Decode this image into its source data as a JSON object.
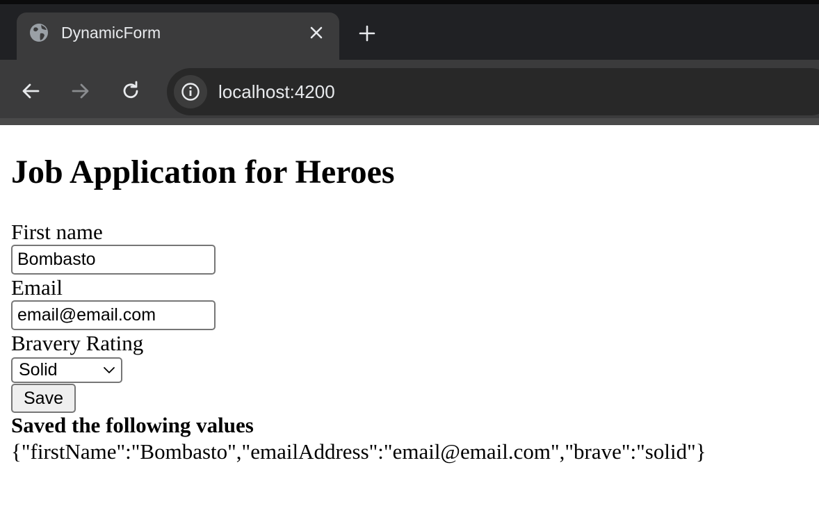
{
  "browser": {
    "tab": {
      "title": "DynamicForm",
      "favicon": "globe-icon"
    },
    "new_tab_icon": "plus-icon",
    "close_icon": "close-icon",
    "nav": {
      "back_icon": "arrow-left-icon",
      "forward_icon": "arrow-right-icon",
      "reload_icon": "reload-icon"
    },
    "address": {
      "url": "localhost:4200",
      "site_info_icon": "info-icon"
    },
    "colors": {
      "frame": "#202124",
      "toolbar": "#3b3b3c",
      "omnibox": "#282828",
      "text": "#e8eaed"
    }
  },
  "page": {
    "heading": "Job Application for Heroes",
    "form": {
      "first_name": {
        "label": "First name",
        "value": "Bombasto"
      },
      "email": {
        "label": "Email",
        "value": "email@email.com"
      },
      "bravery": {
        "label": "Bravery Rating",
        "selected": "Solid"
      },
      "save_label": "Save"
    },
    "result": {
      "heading": "Saved the following values",
      "json": "{\"firstName\":\"Bombasto\",\"emailAddress\":\"email@email.com\",\"brave\":\"solid\"}"
    }
  }
}
